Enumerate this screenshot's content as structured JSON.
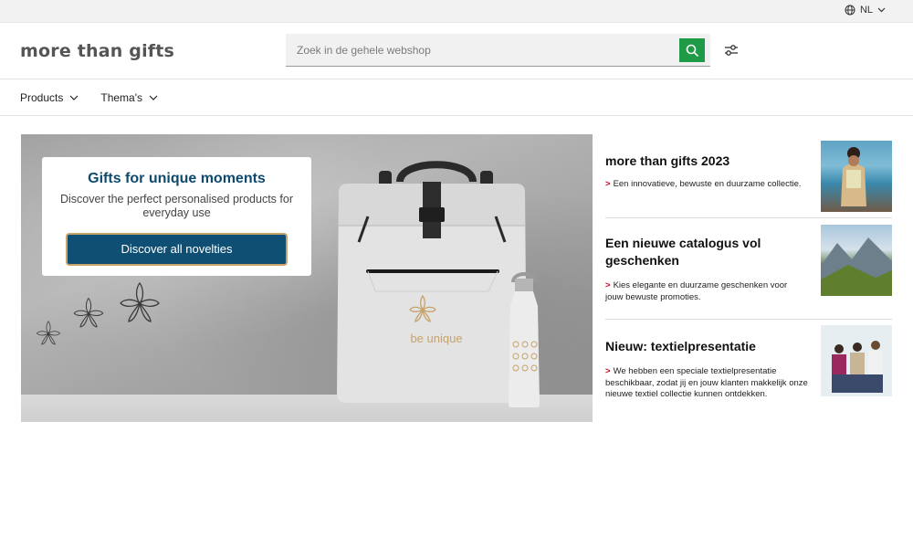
{
  "topbar": {
    "language": "NL"
  },
  "header": {
    "logo": "more than gifts",
    "search_placeholder": "Zoek in de gehele webshop"
  },
  "nav": {
    "items": [
      {
        "label": "Products"
      },
      {
        "label": "Thema's"
      }
    ]
  },
  "hero": {
    "title": "Gifts for unique moments",
    "subtitle": "Discover the perfect personalised products for everyday use",
    "button": "Discover all novelties",
    "product_print": "be unique"
  },
  "articles": [
    {
      "title": "more than gifts 2023",
      "text": "Een innovatieve, bewuste en duurzame collectie."
    },
    {
      "title": "Een nieuwe catalogus vol geschenken",
      "text": "Kies elegante en duurzame geschenken voor jouw bewuste promoties."
    },
    {
      "title": "Nieuw: textielpresentatie",
      "text": "We hebben een speciale textielpresentatie beschikbaar, zodat jij en jouw klanten makkelijk onze nieuwe textiel collectie kunnen ontdekken."
    }
  ],
  "colors": {
    "brand_blue": "#0e4f73",
    "search_green": "#1f9a47",
    "accent_red": "#d0021b"
  }
}
